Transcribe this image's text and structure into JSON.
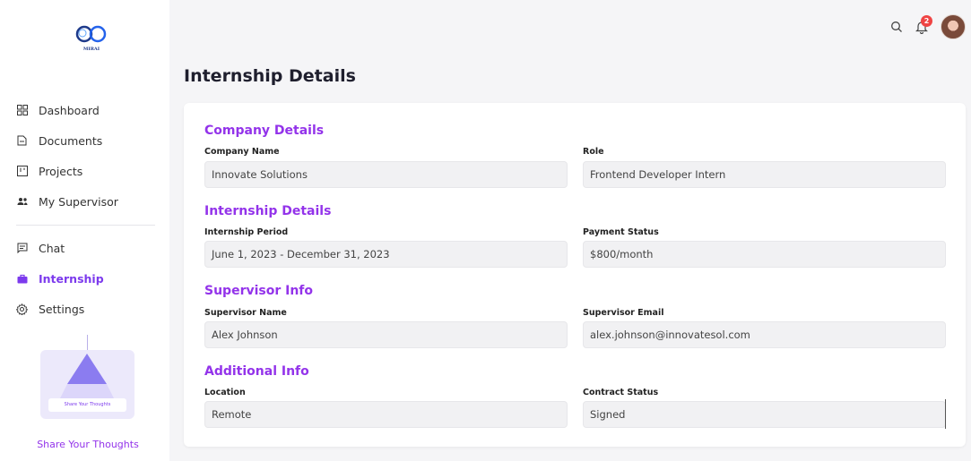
{
  "sidebar": {
    "logo_text": "MIRAI",
    "items_top": [
      {
        "label": "Dashboard",
        "icon": "dashboard-icon"
      },
      {
        "label": "Documents",
        "icon": "document-icon"
      },
      {
        "label": "Projects",
        "icon": "projects-icon"
      },
      {
        "label": "My Supervisor",
        "icon": "users-icon"
      }
    ],
    "items_bottom": [
      {
        "label": "Chat",
        "icon": "chat-icon"
      },
      {
        "label": "Internship",
        "icon": "briefcase-icon",
        "active": true
      },
      {
        "label": "Settings",
        "icon": "gear-icon"
      }
    ],
    "promo_button": "Share Your Thoughts",
    "promo_link": "Share Your Thoughts"
  },
  "topbar": {
    "notification_count": "2"
  },
  "page": {
    "title": "Internship Details"
  },
  "sections": {
    "company": {
      "title": "Company Details",
      "company_name_label": "Company Name",
      "company_name_value": "Innovate Solutions",
      "role_label": "Role",
      "role_value": "Frontend Developer Intern"
    },
    "internship": {
      "title": "Internship Details",
      "period_label": "Internship Period",
      "period_value": "June 1, 2023 - December 31, 2023",
      "payment_label": "Payment Status",
      "payment_value": "$800/month"
    },
    "supervisor": {
      "title": "Supervisor Info",
      "name_label": "Supervisor Name",
      "name_value": "Alex Johnson",
      "email_label": "Supervisor Email",
      "email_value": "alex.johnson@innovatesol.com"
    },
    "additional": {
      "title": "Additional Info",
      "location_label": "Location",
      "location_value": "Remote",
      "contract_label": "Contract Status",
      "contract_value": "Signed"
    }
  },
  "colors": {
    "accent": "#9333ea",
    "badge": "#ef4444",
    "field_bg": "#f1f1f3"
  }
}
